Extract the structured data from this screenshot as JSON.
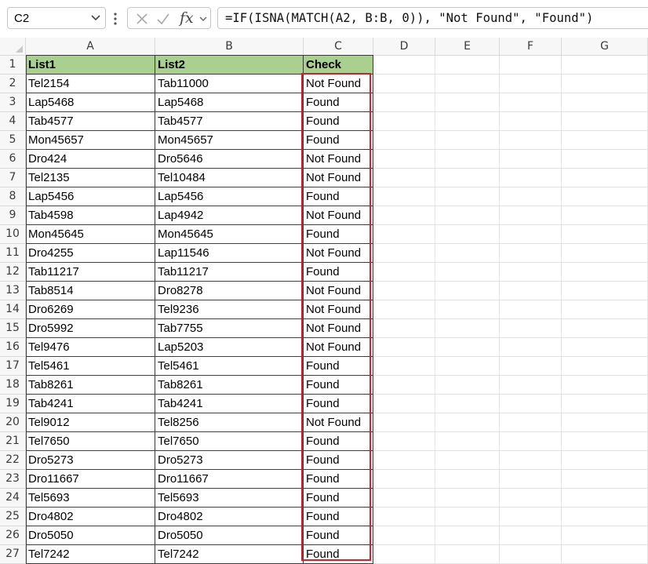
{
  "name_box": {
    "value": "C2",
    "icon": "chevron-down-icon"
  },
  "formula_bar": {
    "cancel_icon": "close-icon",
    "enter_icon": "checkmark-icon",
    "function_label": "fx",
    "formula": "=IF(ISNA(MATCH(A2, B:B, 0)), \"Not Found\", \"Found\")"
  },
  "sheet": {
    "columns": [
      "A",
      "B",
      "C",
      "D",
      "E",
      "F",
      "G"
    ],
    "header_row": {
      "row": "1",
      "a": "List1",
      "b": "List2",
      "c": "Check"
    },
    "rows": [
      {
        "row": "2",
        "a": "Tel2154",
        "b": "Tab11000",
        "c": "Not Found"
      },
      {
        "row": "3",
        "a": "Lap5468",
        "b": "Lap5468",
        "c": "Found"
      },
      {
        "row": "4",
        "a": "Tab4577",
        "b": "Tab4577",
        "c": "Found"
      },
      {
        "row": "5",
        "a": "Mon45657",
        "b": "Mon45657",
        "c": "Found"
      },
      {
        "row": "6",
        "a": "Dro424",
        "b": "Dro5646",
        "c": "Not Found"
      },
      {
        "row": "7",
        "a": "Tel2135",
        "b": "Tel10484",
        "c": "Not Found"
      },
      {
        "row": "8",
        "a": "Lap5456",
        "b": "Lap5456",
        "c": "Found"
      },
      {
        "row": "9",
        "a": "Tab4598",
        "b": "Lap4942",
        "c": "Not Found"
      },
      {
        "row": "10",
        "a": "Mon45645",
        "b": "Mon45645",
        "c": "Found"
      },
      {
        "row": "11",
        "a": "Dro4255",
        "b": "Lap11546",
        "c": "Not Found"
      },
      {
        "row": "12",
        "a": "Tab11217",
        "b": "Tab11217",
        "c": "Found"
      },
      {
        "row": "13",
        "a": "Tab8514",
        "b": "Dro8278",
        "c": "Not Found"
      },
      {
        "row": "14",
        "a": "Dro6269",
        "b": "Tel9236",
        "c": "Not Found"
      },
      {
        "row": "15",
        "a": "Dro5992",
        "b": "Tab7755",
        "c": "Not Found"
      },
      {
        "row": "16",
        "a": "Tel9476",
        "b": "Lap5203",
        "c": "Not Found"
      },
      {
        "row": "17",
        "a": "Tel5461",
        "b": "Tel5461",
        "c": "Found"
      },
      {
        "row": "18",
        "a": "Tab8261",
        "b": "Tab8261",
        "c": "Found"
      },
      {
        "row": "19",
        "a": "Tab4241",
        "b": "Tab4241",
        "c": "Found"
      },
      {
        "row": "20",
        "a": "Tel9012",
        "b": "Tel8256",
        "c": "Not Found"
      },
      {
        "row": "21",
        "a": "Tel7650",
        "b": "Tel7650",
        "c": "Found"
      },
      {
        "row": "22",
        "a": "Dro5273",
        "b": "Dro5273",
        "c": "Found"
      },
      {
        "row": "23",
        "a": "Dro11667",
        "b": "Dro11667",
        "c": "Found"
      },
      {
        "row": "24",
        "a": "Tel5693",
        "b": "Tel5693",
        "c": "Found"
      },
      {
        "row": "25",
        "a": "Dro4802",
        "b": "Dro4802",
        "c": "Found"
      },
      {
        "row": "26",
        "a": "Dro5050",
        "b": "Dro5050",
        "c": "Found"
      },
      {
        "row": "27",
        "a": "Tel7242",
        "b": "Tel7242",
        "c": "Found"
      }
    ]
  },
  "colors": {
    "header_fill": "#a9d08e",
    "highlight_border": "#d81e28",
    "gridline": "#d4d4d4",
    "table_border": "#3a3a3a"
  }
}
